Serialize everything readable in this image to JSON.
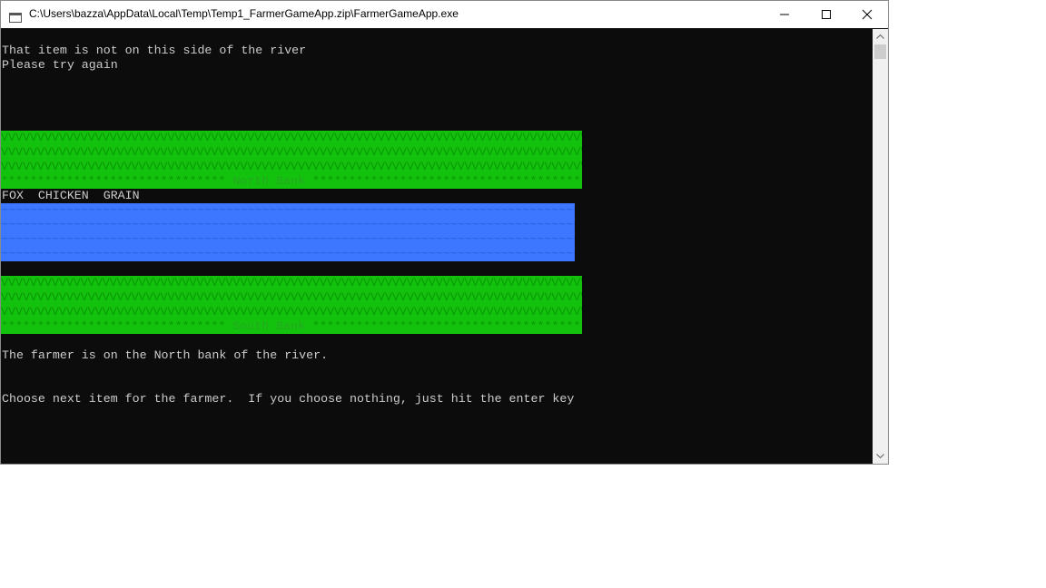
{
  "window": {
    "title": "C:\\Users\\bazza\\AppData\\Local\\Temp\\Temp1_FarmerGameApp.zip\\FarmerGameApp.exe"
  },
  "console": {
    "message_line1": "That item is not on this side of the river",
    "message_line2": "Please try again",
    "north_bank_label": "North Bank",
    "north_bank_items": "FOX  CHICKEN  GRAIN",
    "south_bank_label": "South Bank",
    "farmer_status": "The farmer is on the North bank of the river.",
    "prompt": "Choose next item for the farmer.  If you choose nothing, just hit the enter key"
  },
  "colors": {
    "bank": "#13c20d",
    "river": "#3b78ff",
    "console_bg": "#0c0c0c",
    "console_text": "#cccccc"
  },
  "icons": {
    "app": "console-app-icon",
    "minimize": "minimize-icon",
    "maximize": "maximize-icon",
    "close": "close-icon",
    "scroll_up": "chevron-up-icon",
    "scroll_down": "chevron-down-icon"
  }
}
